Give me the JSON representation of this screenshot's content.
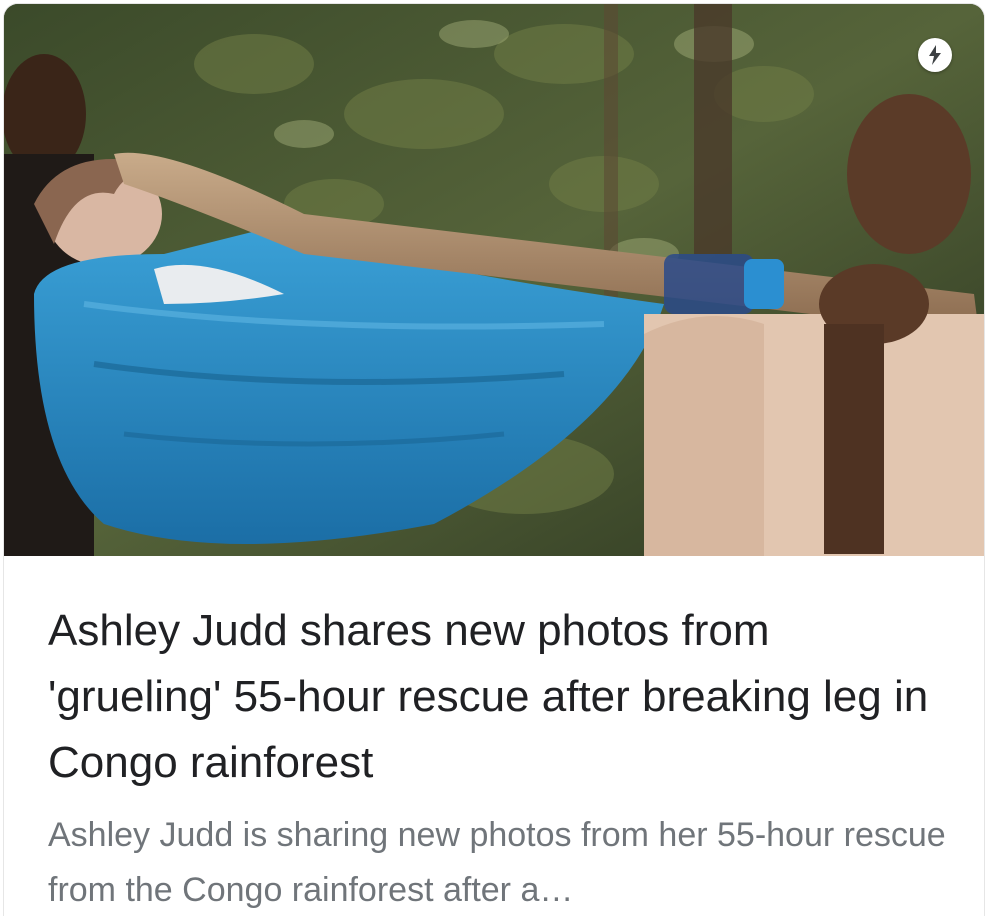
{
  "article": {
    "image_alt": "Ashley Judd being carried in a blue sling through the rainforest",
    "amp_icon": "lightning-bolt-icon",
    "headline": "Ashley Judd shares new photos from 'grueling' 55-hour rescue after breaking leg in Congo rainforest",
    "snippet": "Ashley Judd is sharing new photos from her 55-hour rescue from the Congo rainforest after a…"
  },
  "colors": {
    "headline": "#202124",
    "snippet": "#70757a",
    "sling": "#2a8cc4"
  }
}
